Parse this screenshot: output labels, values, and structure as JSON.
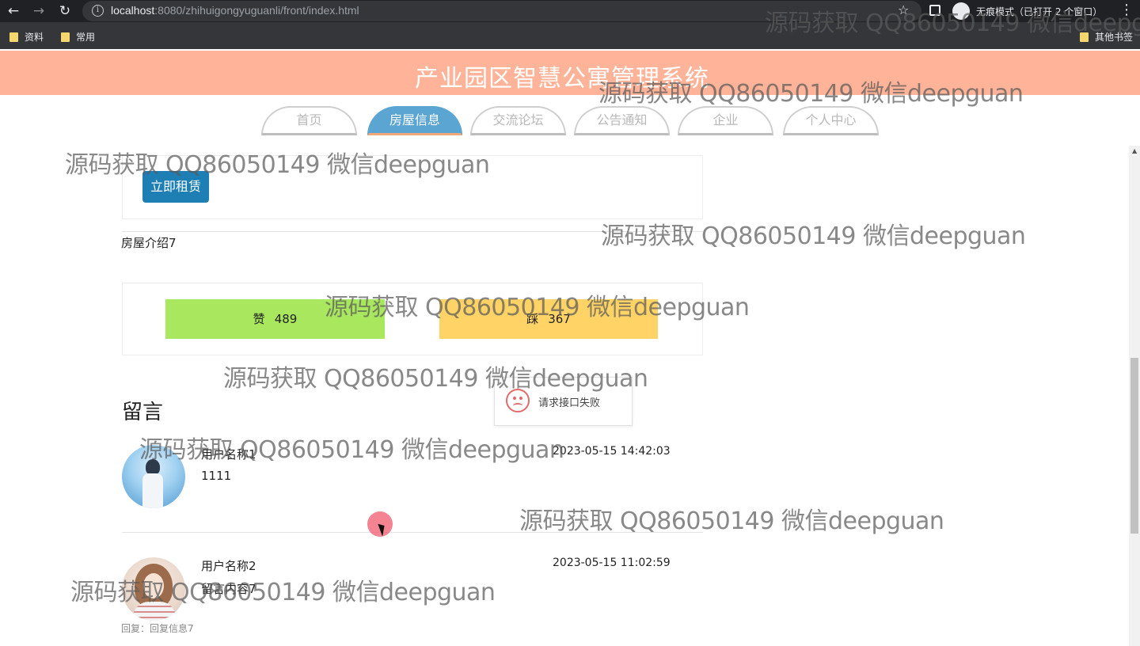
{
  "browser": {
    "url_host": "localhost",
    "url_path": ":8080/zhihuigongyuguanli/front/index.html",
    "incognito_label": "无痕模式（已打开 2 个窗口）",
    "bookmarks": [
      "资料",
      "常用"
    ],
    "other_bookmarks": "其他书签"
  },
  "site": {
    "title": "产业园区智慧公寓管理系统"
  },
  "nav": {
    "tabs": [
      "首页",
      "房屋信息",
      "交流论坛",
      "公告通知",
      "企业",
      "个人中心"
    ],
    "active": "房屋信息"
  },
  "detail": {
    "rent_button": "立即租赁",
    "intro": "房屋介绍7",
    "like_label": "赞",
    "like_count": "489",
    "dislike_label": "踩",
    "dislike_count": "367"
  },
  "toast": {
    "message": "请求接口失败"
  },
  "comments": {
    "heading": "留言",
    "items": [
      {
        "user": "用户名称1",
        "content": "1111",
        "time": "2023-05-15 14:42:03"
      },
      {
        "user": "用户名称2",
        "content": "留言内容7",
        "time": "2023-05-15 11:02:59",
        "reply": "回复：回复信息7"
      }
    ]
  },
  "watermark": {
    "text": "源码获取 QQ86050149 微信deepguan",
    "top_right": "源码获取 QQ86050149 微信deepgu"
  },
  "colors": {
    "header": "#ffb398",
    "active_tab": "#5ba5d3",
    "rent_button": "#1d7fb4",
    "like": "#a9e85e",
    "dislike": "#ffd366"
  }
}
